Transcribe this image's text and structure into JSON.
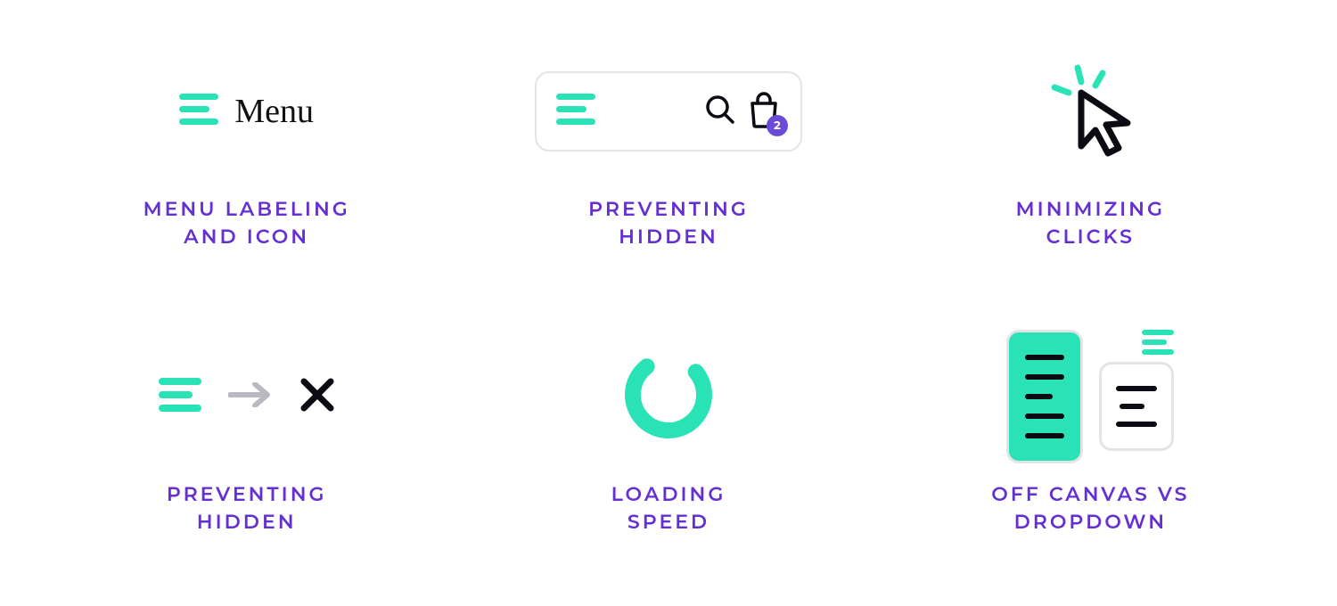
{
  "colors": {
    "accent": "#29E3B7",
    "caption": "#6530D2",
    "badge": "#6A4BD8",
    "ink": "#0b0b14",
    "border": "#e4e4e4"
  },
  "cards": [
    {
      "caption": "MENU LABELING\nAND ICON",
      "menu_word": "Menu"
    },
    {
      "caption": "PREVENTING\nHIDDEN",
      "bag_badge": "2"
    },
    {
      "caption": "MINIMIZING\nCLICKS"
    },
    {
      "caption": "PREVENTING\nHIDDEN"
    },
    {
      "caption": "LOADING\nSPEED"
    },
    {
      "caption": "OFF CANVAS VS\nDROPDOWN"
    }
  ]
}
